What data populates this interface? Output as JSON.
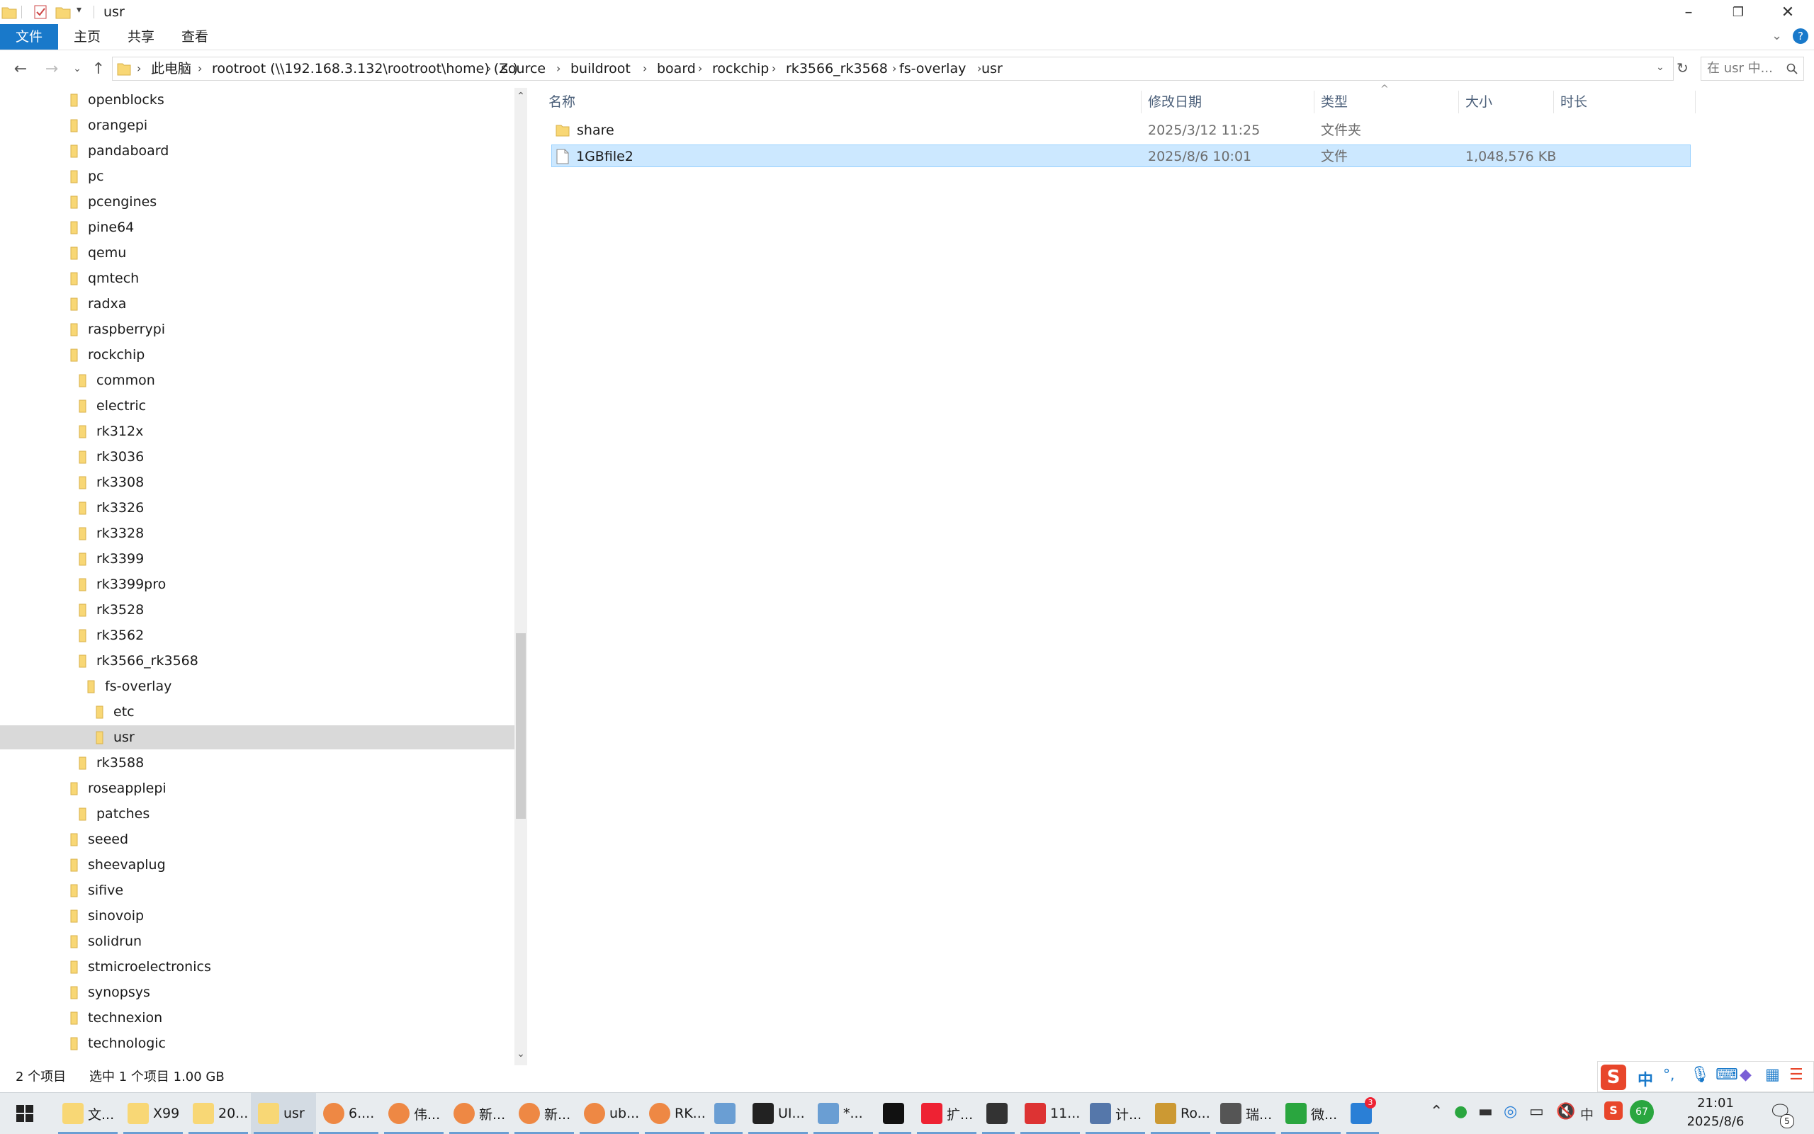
{
  "window": {
    "title": "usr"
  },
  "ribbon": {
    "tabs": [
      "文件",
      "主页",
      "共享",
      "查看"
    ]
  },
  "address": {
    "crumbs": [
      "此电脑",
      "rootroot (\\\\192.168.3.132\\rootroot\\home) (Z:)",
      "source",
      "buildroot",
      "board",
      "rockchip",
      "rk3566_rk3568",
      "fs-overlay",
      "usr"
    ],
    "search_placeholder": "在 usr 中..."
  },
  "nav_tree": [
    {
      "label": "openblocks",
      "level": 0
    },
    {
      "label": "orangepi",
      "level": 0
    },
    {
      "label": "pandaboard",
      "level": 0
    },
    {
      "label": "pc",
      "level": 0
    },
    {
      "label": "pcengines",
      "level": 0
    },
    {
      "label": "pine64",
      "level": 0
    },
    {
      "label": "qemu",
      "level": 0
    },
    {
      "label": "qmtech",
      "level": 0
    },
    {
      "label": "radxa",
      "level": 0
    },
    {
      "label": "raspberrypi",
      "level": 0
    },
    {
      "label": "rockchip",
      "level": 0
    },
    {
      "label": "common",
      "level": 1
    },
    {
      "label": "electric",
      "level": 1
    },
    {
      "label": "rk312x",
      "level": 1
    },
    {
      "label": "rk3036",
      "level": 1
    },
    {
      "label": "rk3308",
      "level": 1
    },
    {
      "label": "rk3326",
      "level": 1
    },
    {
      "label": "rk3328",
      "level": 1
    },
    {
      "label": "rk3399",
      "level": 1
    },
    {
      "label": "rk3399pro",
      "level": 1
    },
    {
      "label": "rk3528",
      "level": 1
    },
    {
      "label": "rk3562",
      "level": 1
    },
    {
      "label": "rk3566_rk3568",
      "level": 1
    },
    {
      "label": "fs-overlay",
      "level": 2
    },
    {
      "label": "etc",
      "level": 3
    },
    {
      "label": "usr",
      "level": 3,
      "selected": true
    },
    {
      "label": "rk3588",
      "level": 1
    },
    {
      "label": "roseapplepi",
      "level": 0
    },
    {
      "label": "patches",
      "level": 1
    },
    {
      "label": "seeed",
      "level": 0
    },
    {
      "label": "sheevaplug",
      "level": 0
    },
    {
      "label": "sifive",
      "level": 0
    },
    {
      "label": "sinovoip",
      "level": 0
    },
    {
      "label": "solidrun",
      "level": 0
    },
    {
      "label": "stmicroelectronics",
      "level": 0
    },
    {
      "label": "synopsys",
      "level": 0
    },
    {
      "label": "technexion",
      "level": 0
    },
    {
      "label": "technologic",
      "level": 0
    }
  ],
  "columns": {
    "name": "名称",
    "modified": "修改日期",
    "type": "类型",
    "size": "大小",
    "duration": "时长"
  },
  "files": [
    {
      "name": "share",
      "modified": "2025/3/12 11:25",
      "type": "文件夹",
      "size": "",
      "kind": "folder",
      "selected": false
    },
    {
      "name": "1GBfile2",
      "modified": "2025/8/6 10:01",
      "type": "文件",
      "size": "1,048,576 KB",
      "kind": "file",
      "selected": true
    }
  ],
  "status": {
    "count": "2 个项目",
    "selection": "选中 1 个项目  1.00 GB"
  },
  "taskbar": {
    "items": [
      "文...",
      "X99",
      "20...",
      "usr",
      "6....",
      "伟...",
      "新...",
      "新...",
      "ub...",
      "RK...",
      "",
      "UI...",
      "*...",
      "",
      "扩...",
      "",
      "11...",
      "计...",
      "Ro...",
      "瑞...",
      "微...",
      ""
    ],
    "clock_time": "21:01",
    "clock_date": "2025/8/6",
    "notification_count": "5",
    "cloud_badge": "3"
  },
  "ime": {
    "mode": "中",
    "punct": "°,"
  },
  "colors": {
    "accent": "#1979ca",
    "folder": "#f8d775",
    "selection": "#cce8ff"
  }
}
